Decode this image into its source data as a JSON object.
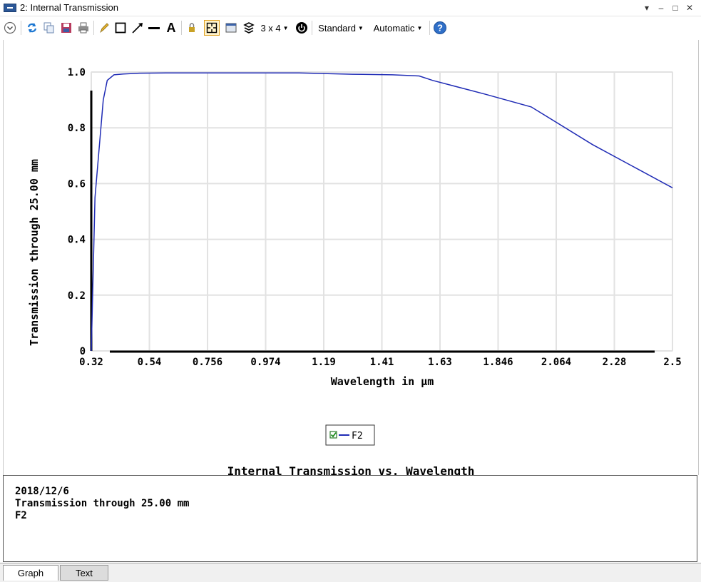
{
  "window": {
    "title": "2: Internal Transmission"
  },
  "toolbar": {
    "layout_label": "3 x 4",
    "standard_label": "Standard",
    "automatic_label": "Automatic",
    "icons": [
      "chevron-down-icon",
      "refresh-icon",
      "copy-icon",
      "save-icon",
      "print-icon",
      "pencil-icon",
      "rectangle-icon",
      "arrow-icon",
      "line-icon",
      "text-icon",
      "lock-icon",
      "crosshair-icon",
      "window-icon",
      "layers-icon",
      "power-icon",
      "help-icon"
    ]
  },
  "chart_data": {
    "type": "line",
    "title": "Internal Transmission vs. Wavelength",
    "xlabel": "Wavelength in µm",
    "ylabel": "Transmission through 25.00 mm",
    "xlim": [
      0.32,
      2.5
    ],
    "ylim": [
      0,
      1.0
    ],
    "x_ticks": [
      "0.32",
      "0.54",
      "0.756",
      "0.974",
      "1.19",
      "1.41",
      "1.63",
      "1.846",
      "2.064",
      "2.28",
      "2.5"
    ],
    "y_ticks": [
      "0",
      "0.2",
      "0.4",
      "0.6",
      "0.8",
      "1.0"
    ],
    "grid": true,
    "legend": "bottom-center",
    "series": [
      {
        "name": "F2",
        "color": "#1f2bb5",
        "x": [
          0.32,
          0.334,
          0.365,
          0.38,
          0.405,
          0.44,
          0.5,
          0.6,
          0.8,
          1.1,
          1.3,
          1.45,
          1.55,
          1.6,
          1.8,
          1.97,
          2.2,
          2.5
        ],
        "y": [
          0.0,
          0.55,
          0.9,
          0.97,
          0.99,
          0.993,
          0.996,
          0.997,
          0.997,
          0.997,
          0.992,
          0.99,
          0.986,
          0.97,
          0.92,
          0.875,
          0.74,
          0.585
        ]
      }
    ]
  },
  "info": {
    "date": "2018/12/6",
    "description": "Transmission through 25.00 mm",
    "glass": "F2"
  },
  "tabs": [
    {
      "label": "Graph",
      "active": true
    },
    {
      "label": "Text",
      "active": false
    }
  ]
}
